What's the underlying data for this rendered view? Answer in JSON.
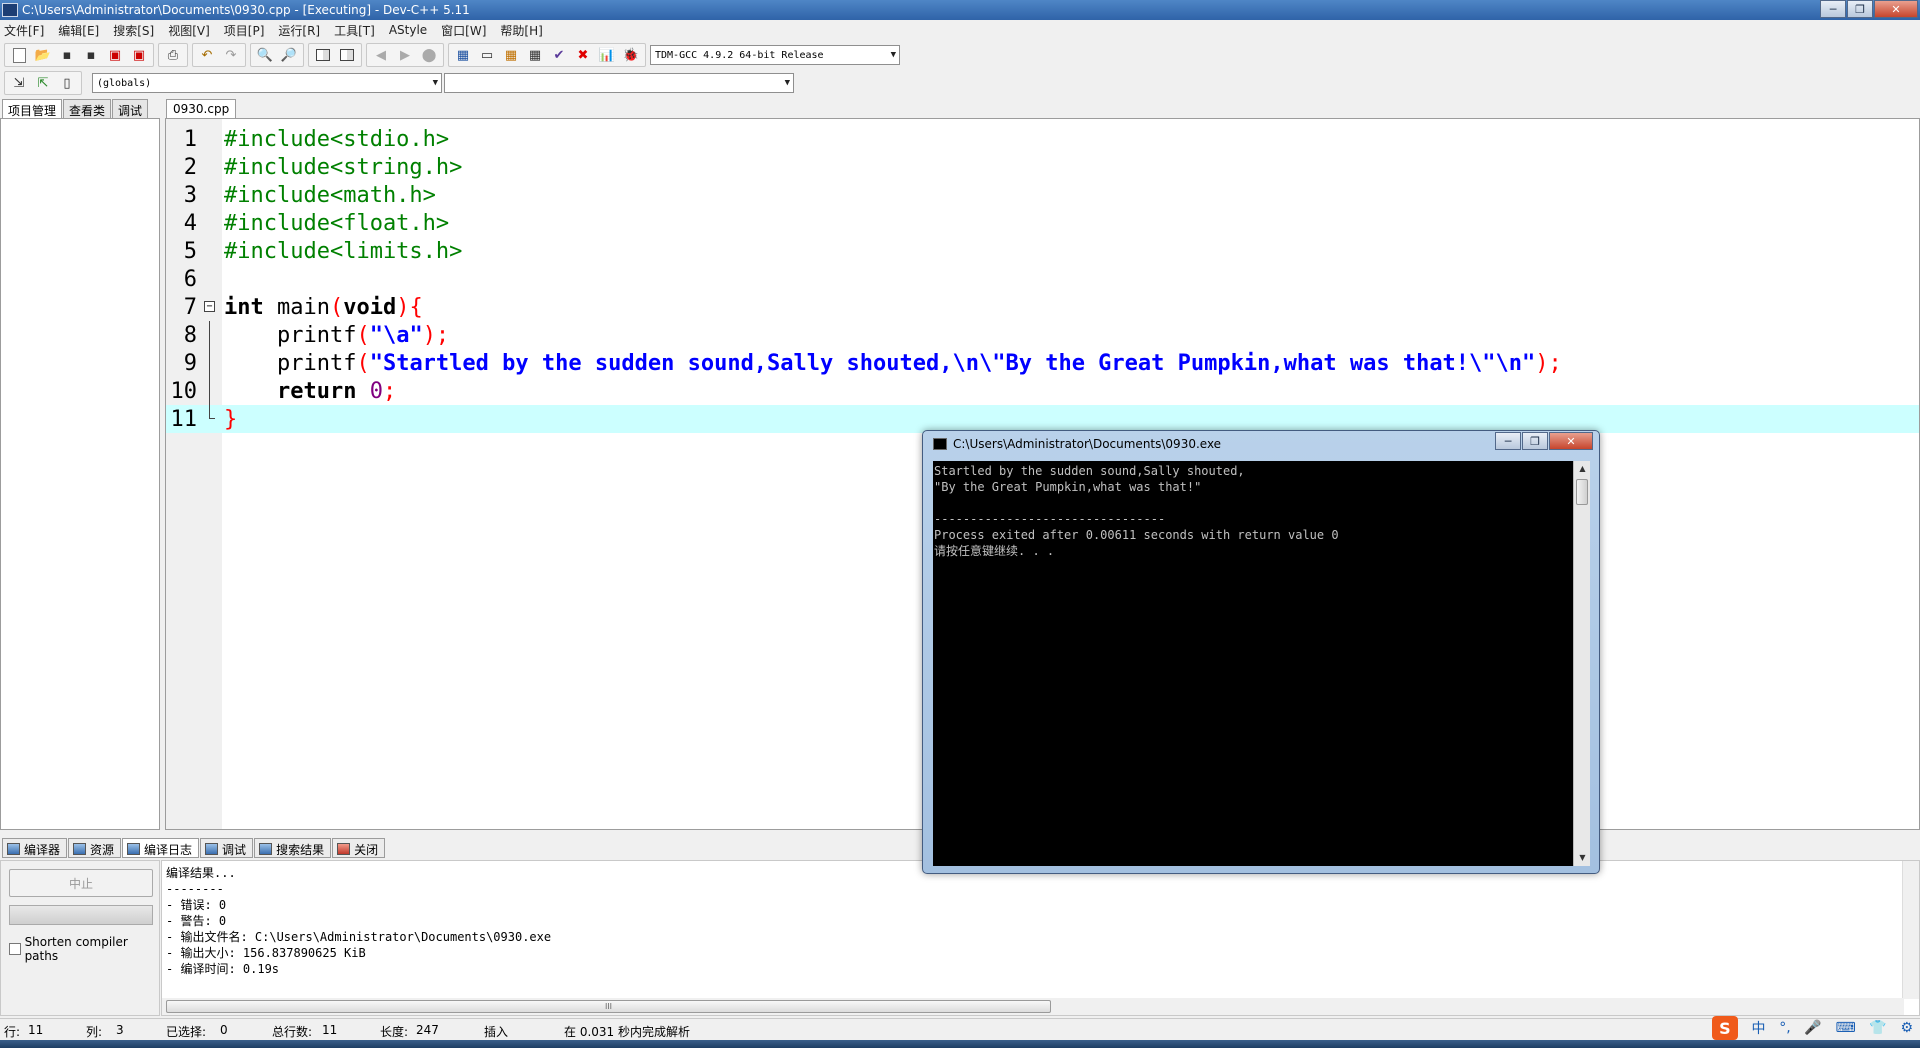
{
  "window": {
    "title": "C:\\Users\\Administrator\\Documents\\0930.cpp - [Executing] - Dev-C++ 5.11",
    "controls": [
      "─",
      "❐",
      "✕"
    ]
  },
  "menu": [
    "文件[F]",
    "编辑[E]",
    "搜索[S]",
    "视图[V]",
    "项目[P]",
    "运行[R]",
    "工具[T]",
    "AStyle",
    "窗口[W]",
    "帮助[H]"
  ],
  "toolbar": {
    "compiler_select": "TDM-GCC 4.9.2 64-bit Release",
    "scope_select": "(globals)",
    "function_select": ""
  },
  "left_panel": {
    "tabs": [
      "项目管理",
      "查看类",
      "调试"
    ]
  },
  "editor": {
    "tab_label": "0930.cpp",
    "current_line": 11,
    "lines": [
      {
        "n": "1",
        "code": "#include<stdio.h>"
      },
      {
        "n": "2",
        "code": "#include<string.h>"
      },
      {
        "n": "3",
        "code": "#include<math.h>"
      },
      {
        "n": "4",
        "code": "#include<float.h>"
      },
      {
        "n": "5",
        "code": "#include<limits.h>"
      },
      {
        "n": "6",
        "code": ""
      },
      {
        "n": "7",
        "kw": "int",
        "plain": " main",
        "sym1": "(",
        "kw2": "void",
        "sym2": "){"
      },
      {
        "n": "8",
        "plain": "    printf",
        "sym1": "(",
        "str": "\"\\a\"",
        "sym2": ");"
      },
      {
        "n": "9",
        "plain": "    printf",
        "sym1": "(",
        "str": "\"Startled by the sudden sound,Sally shouted,\\n\\\"By the Great Pumpkin,what was that!\\\"\\n\"",
        "sym2": ");"
      },
      {
        "n": "10",
        "kw": "    return",
        "num": " 0",
        "sym2": ";"
      },
      {
        "n": "11",
        "sym2": "}"
      }
    ]
  },
  "bottom": {
    "tabs": [
      "编译器",
      "资源",
      "编译日志",
      "调试",
      "搜索结果",
      "关闭"
    ],
    "active_tab": "编译日志",
    "stop_button": "中止",
    "shorten_paths_label": "Shorten compiler paths",
    "log_lines": [
      "编译结果...",
      "--------",
      "- 错误: 0",
      "- 警告: 0",
      "- 输出文件名: C:\\Users\\Administrator\\Documents\\0930.exe",
      "- 输出大小: 156.837890625 KiB",
      "- 编译时间: 0.19s"
    ],
    "scroll_thumb": "III"
  },
  "statusbar": {
    "row_label": "行:",
    "row": "11",
    "col_label": "列:",
    "col": "3",
    "sel_label": "已选择:",
    "sel": "0",
    "total_label": "总行数:",
    "total": "11",
    "len_label": "长度:",
    "len": "247",
    "mode": "插入",
    "parse": "在 0.031 秒内完成解析"
  },
  "ime": {
    "logo": "S",
    "items": [
      "中",
      "°,",
      "🎤",
      "⌨",
      "👕",
      "⚙"
    ]
  },
  "console": {
    "title": "C:\\Users\\Administrator\\Documents\\0930.exe",
    "output": [
      "Startled by the sudden sound,Sally shouted,",
      "\"By the Great Pumpkin,what was that!\"",
      "",
      "--------------------------------",
      "Process exited after 0.00611 seconds with return value 0",
      "请按任意键继续. . ."
    ]
  }
}
